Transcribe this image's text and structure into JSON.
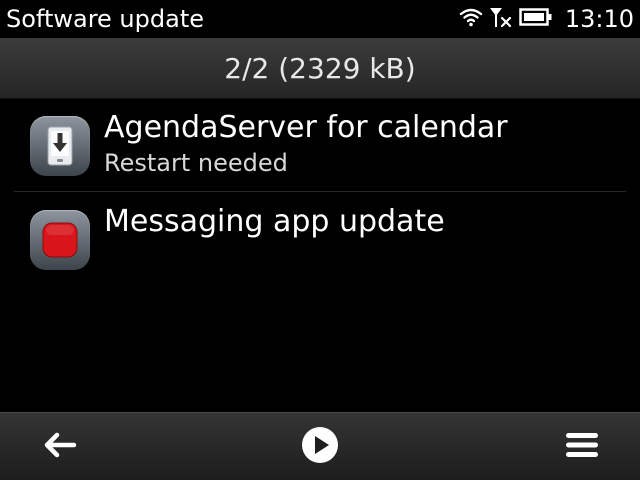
{
  "status_bar": {
    "app_title": "Software update",
    "time": "13:10",
    "icons": [
      "wifi-icon",
      "no-signal-icon",
      "battery-icon"
    ]
  },
  "header": {
    "title": "2/2 (2329 kB)"
  },
  "updates": [
    {
      "title": "AgendaServer for calendar",
      "subtitle": "Restart needed",
      "icon": "download-phone-icon"
    },
    {
      "title": "Messaging app update",
      "subtitle": "",
      "icon": "stop-icon"
    }
  ],
  "toolbar": {
    "icons": [
      "back-arrow-icon",
      "play-icon",
      "menu-icon"
    ]
  },
  "colors": {
    "background": "#000000",
    "header": "#303030",
    "stop_red": "#d9141b"
  }
}
